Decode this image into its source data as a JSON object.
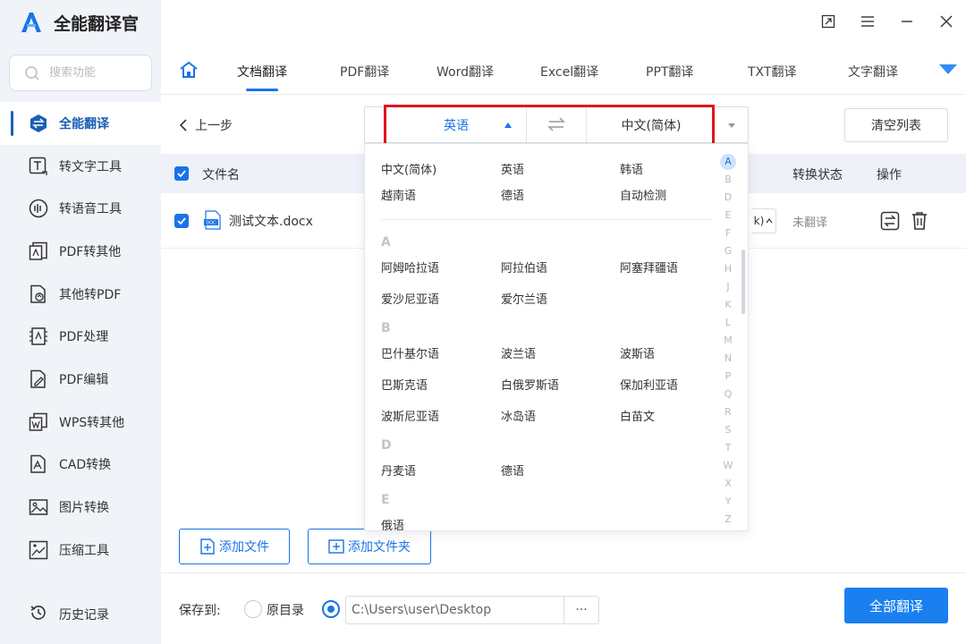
{
  "app": {
    "title": "全能翻译官"
  },
  "search": {
    "placeholder": "搜索功能"
  },
  "sidebar": {
    "items": [
      {
        "label": "全能翻译",
        "icon": "translate-icon"
      },
      {
        "label": "转文字工具",
        "icon": "text-tool-icon"
      },
      {
        "label": "转语音工具",
        "icon": "voice-tool-icon"
      },
      {
        "label": "PDF转其他",
        "icon": "pdf-convert-icon"
      },
      {
        "label": "其他转PDF",
        "icon": "to-pdf-icon"
      },
      {
        "label": "PDF处理",
        "icon": "pdf-process-icon"
      },
      {
        "label": "PDF编辑",
        "icon": "pdf-edit-icon"
      },
      {
        "label": "WPS转其他",
        "icon": "wps-icon"
      },
      {
        "label": "CAD转换",
        "icon": "cad-icon"
      },
      {
        "label": "图片转换",
        "icon": "image-icon"
      },
      {
        "label": "压缩工具",
        "icon": "compress-icon"
      }
    ],
    "history": "历史记录"
  },
  "tabs": [
    "文档翻译",
    "PDF翻译",
    "Word翻译",
    "Excel翻译",
    "PPT翻译",
    "TXT翻译",
    "文字翻译"
  ],
  "toolbar": {
    "back": "上一步",
    "clear": "清空列表"
  },
  "table": {
    "col_name": "文件名",
    "col_status": "转换状态",
    "col_op": "操作",
    "rows": [
      {
        "name": "测试文本.docx",
        "lang_partial": "k)",
        "status": "未翻译"
      }
    ]
  },
  "actions": {
    "add_file": "添加文件",
    "add_folder": "添加文件夹"
  },
  "bottom": {
    "save_label": "保存到:",
    "option_source": "原目录",
    "path": "C:\\Users\\user\\Desktop",
    "more": "···",
    "translate_all": "全部翻译"
  },
  "lang_selector": {
    "source": "英语",
    "target": "中文(简体)"
  },
  "lang_popup": {
    "common": [
      [
        "中文(简体)",
        "英语",
        "韩语"
      ],
      [
        "越南语",
        "德语",
        "自动检测"
      ]
    ],
    "sections": [
      {
        "letter": "A",
        "rows": [
          [
            "阿姆哈拉语",
            "阿拉伯语",
            "阿塞拜疆语"
          ],
          [
            "爱沙尼亚语",
            "爱尔兰语"
          ]
        ]
      },
      {
        "letter": "B",
        "rows": [
          [
            "巴什基尔语",
            "波兰语",
            "波斯语"
          ],
          [
            "巴斯克语",
            "白俄罗斯语",
            "保加利亚语"
          ],
          [
            "波斯尼亚语",
            "冰岛语",
            "白苗文"
          ]
        ]
      },
      {
        "letter": "D",
        "rows": [
          [
            "丹麦语",
            "德语"
          ]
        ]
      },
      {
        "letter": "E",
        "rows": [
          [
            "俄语"
          ]
        ]
      }
    ],
    "alphabet": [
      "A",
      "B",
      "D",
      "E",
      "F",
      "G",
      "H",
      "J",
      "K",
      "L",
      "M",
      "N",
      "P",
      "Q",
      "R",
      "S",
      "T",
      "W",
      "X",
      "Y",
      "Z"
    ]
  },
  "colors": {
    "accent": "#1a73e8",
    "highlight": "#e0141e",
    "sidebar_bg": "#f0f3f8"
  }
}
